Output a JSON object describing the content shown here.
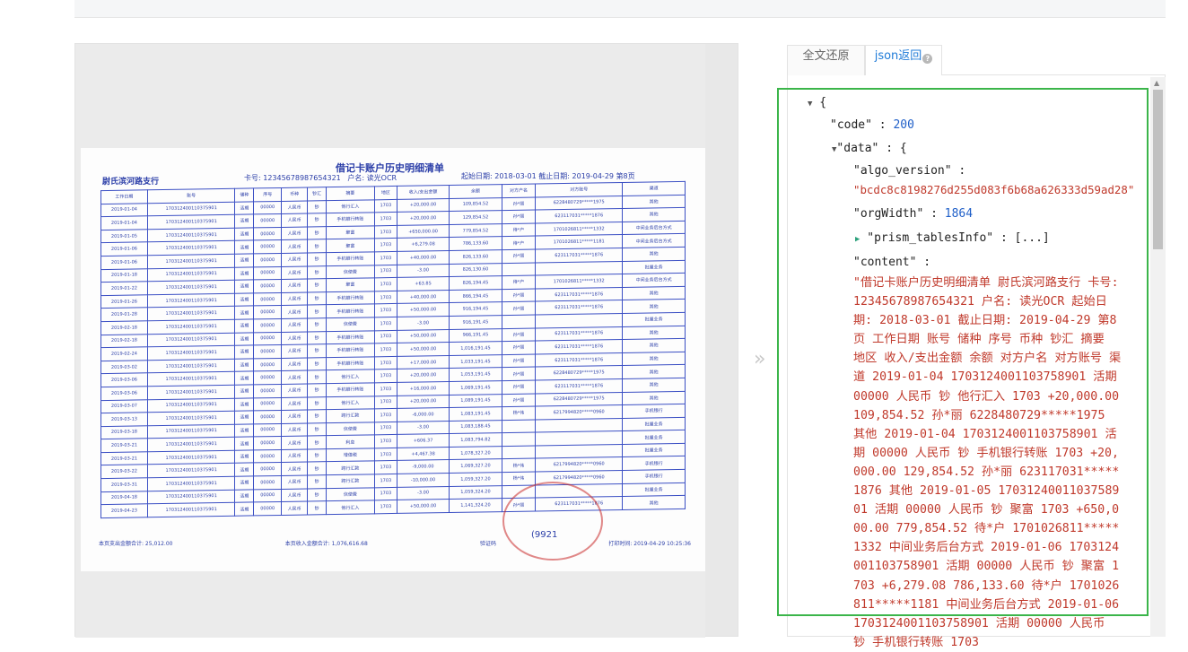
{
  "preview": {
    "doc_title": "借记卡账户历史明细清单",
    "bank": "尉氏滨河路支行",
    "card_label": "卡号: 12345678987654321",
    "owner": "户名: 读光OCR",
    "period": "起始日期: 2018-03-01  截止日期: 2019-04-29  第8页",
    "headers": [
      "工作日期",
      "账号",
      "储种",
      "序号",
      "币种",
      "钞汇",
      "摘要",
      "地区",
      "收入/支出金额",
      "余额",
      "对方户名",
      "对方账号",
      "渠道"
    ],
    "rows": [
      [
        "2019-01-04",
        "170312400110375901",
        "活期",
        "00000",
        "人民币",
        "钞",
        "他行汇入",
        "1703",
        "+20,000.00",
        "109,854.52",
        "孙*丽",
        "6228480729*****1975",
        "其他"
      ],
      [
        "2019-01-04",
        "170312400110375901",
        "活期",
        "00000",
        "人民币",
        "钞",
        "手机银行转账",
        "1703",
        "+20,000.00",
        "129,854.52",
        "孙*丽",
        "623117031*****1876",
        "其他"
      ],
      [
        "2019-01-05",
        "170312400110375901",
        "活期",
        "00000",
        "人民币",
        "钞",
        "聚富",
        "1703",
        "+650,000.00",
        "779,854.52",
        "待*户",
        "1701026811*****1332",
        "中间业务后台方式"
      ],
      [
        "2019-01-06",
        "170312400110375901",
        "活期",
        "00000",
        "人民币",
        "钞",
        "聚富",
        "1703",
        "+6,279.08",
        "786,133.60",
        "待*户",
        "1701026811*****1181",
        "中间业务后台方式"
      ],
      [
        "2019-01-06",
        "170312400110375901",
        "活期",
        "00000",
        "人民币",
        "钞",
        "手机银行转账",
        "1703",
        "+40,000.00",
        "826,133.60",
        "孙*丽",
        "623117031*****1876",
        "其他"
      ],
      [
        "2019-01-18",
        "170312400110375901",
        "活期",
        "00000",
        "人民币",
        "钞",
        "信使费",
        "1703",
        "-3.00",
        "826,130.60",
        "",
        "",
        "批量业务"
      ],
      [
        "2019-01-22",
        "170312400110375901",
        "活期",
        "00000",
        "人民币",
        "钞",
        "聚富",
        "1703",
        "+63.85",
        "826,194.45",
        "待*户",
        "1701026811*****1332",
        "中间业务后台方式"
      ],
      [
        "2019-01-26",
        "170312400110375901",
        "活期",
        "00000",
        "人民币",
        "钞",
        "手机银行转账",
        "1703",
        "+40,000.00",
        "866,194.45",
        "孙*丽",
        "623117031*****1876",
        "其他"
      ],
      [
        "2019-01-28",
        "170312400110375901",
        "活期",
        "00000",
        "人民币",
        "钞",
        "手机银行转账",
        "1703",
        "+50,000.00",
        "916,194.45",
        "孙*丽",
        "623117031*****1876",
        "其他"
      ],
      [
        "2019-02-18",
        "170312400110375901",
        "活期",
        "00000",
        "人民币",
        "钞",
        "信使费",
        "1703",
        "-3.00",
        "916,191.45",
        "",
        "",
        "批量业务"
      ],
      [
        "2019-02-18",
        "170312400110375901",
        "活期",
        "00000",
        "人民币",
        "钞",
        "手机银行转账",
        "1703",
        "+50,000.00",
        "966,191.45",
        "孙*丽",
        "623117031*****1876",
        "其他"
      ],
      [
        "2019-02-24",
        "170312400110375901",
        "活期",
        "00000",
        "人民币",
        "钞",
        "手机银行转账",
        "1703",
        "+50,000.00",
        "1,016,191.45",
        "孙*丽",
        "623117031*****1876",
        "其他"
      ],
      [
        "2019-03-02",
        "170312400110375901",
        "活期",
        "00000",
        "人民币",
        "钞",
        "手机银行转账",
        "1703",
        "+17,000.00",
        "1,033,191.45",
        "孙*丽",
        "623117031*****1876",
        "其他"
      ],
      [
        "2019-03-06",
        "170312400110375901",
        "活期",
        "00000",
        "人民币",
        "钞",
        "他行汇入",
        "1703",
        "+20,000.00",
        "1,053,191.45",
        "孙*丽",
        "6228480729*****1975",
        "其他"
      ],
      [
        "2019-03-06",
        "170312400110375901",
        "活期",
        "00000",
        "人民币",
        "钞",
        "手机银行转账",
        "1703",
        "+16,000.00",
        "1,069,191.45",
        "孙*丽",
        "623117031*****1876",
        "其他"
      ],
      [
        "2019-03-07",
        "170312400110375901",
        "活期",
        "00000",
        "人民币",
        "钞",
        "他行汇入",
        "1703",
        "+20,000.00",
        "1,089,191.45",
        "孙*丽",
        "6228480729*****1975",
        "其他"
      ],
      [
        "2019-03-13",
        "170312400110375901",
        "活期",
        "00000",
        "人民币",
        "钞",
        "跨行汇款",
        "1703",
        "-6,000.00",
        "1,083,191.45",
        "杨*伟",
        "6217994820*****0960",
        "手机银行"
      ],
      [
        "2019-03-18",
        "170312400110375901",
        "活期",
        "00000",
        "人民币",
        "钞",
        "信使费",
        "1703",
        "-3.00",
        "1,083,188.45",
        "",
        "",
        "批量业务"
      ],
      [
        "2019-03-21",
        "170312400110375901",
        "活期",
        "00000",
        "人民币",
        "钞",
        "利息",
        "1703",
        "+606.37",
        "1,083,794.82",
        "",
        "",
        "批量业务"
      ],
      [
        "2019-03-21",
        "170312400110375901",
        "活期",
        "00000",
        "人民币",
        "钞",
        "增值税",
        "1703",
        "+4,467.38",
        "1,078,327.20",
        "",
        "",
        "批量业务"
      ],
      [
        "2019-03-22",
        "170312400110375901",
        "活期",
        "00000",
        "人民币",
        "钞",
        "跨行汇款",
        "1703",
        "-9,000.00",
        "1,069,327.20",
        "杨*伟",
        "6217994820*****0960",
        "手机银行"
      ],
      [
        "2019-03-31",
        "170312400110375901",
        "活期",
        "00000",
        "人民币",
        "钞",
        "跨行汇款",
        "1703",
        "-10,000.00",
        "1,059,327.20",
        "杨*伟",
        "6217994820*****0960",
        "手机银行"
      ],
      [
        "2019-04-18",
        "170312400110375901",
        "活期",
        "00000",
        "人民币",
        "钞",
        "信使费",
        "1703",
        "-3.00",
        "1,059,324.20",
        "",
        "",
        "批量业务"
      ],
      [
        "2019-04-23",
        "170312400110375901",
        "活期",
        "00000",
        "人民币",
        "钞",
        "他行汇入",
        "1703",
        "+50,000.00",
        "1,141,324.20",
        "孙*丽",
        "623117031*****1876",
        "其他"
      ]
    ],
    "footer_left": "本页支出金额合计: 25,012.00",
    "footer_mid": "本页收入金额合计: 1,076,616.68",
    "footer_right": "验证码",
    "footer_print": "打印时间: 2019-04-29 10:25:36",
    "stamp_text": "(9921"
  },
  "tabs": {
    "full_text": "全文还原",
    "json_return": "json返回",
    "help": "?"
  },
  "json_view": {
    "open_brace": "{",
    "code_key": "\"code\"",
    "code_val": "200",
    "data_key": "\"data\"",
    "data_open": "{",
    "algo_key": "\"algo_version\"",
    "algo_val": "\"bcdc8c8198276d255d083f6b68a626333d59ad28\"",
    "orgwidth_key": "\"orgWidth\"",
    "orgwidth_val": "1864",
    "prism_key": "\"prism_tablesInfo\"",
    "prism_val": "[...]",
    "content_key": "\"content\"",
    "content_val": "\"借记卡账户历史明细清单 尉氏滨河路支行 卡号: 12345678987654321 户名: 读光OCR 起始日期: 2018-03-01 截止日期: 2019-04-29 第8页 工作日期 账号 储种 序号 币种 钞汇 摘要 地区 收入/支出金额 余额 对方户名 对方账号 渠道 2019-01-04 1703124001103758901 活期 00000 人民币 钞 他行汇入 1703 +20,000.00 109,854.52 孙*丽 6228480729*****1975 其他 2019-01-04 1703124001103758901 活期 00000 人民币 钞 手机银行转账 1703 +20,000.00 129,854.52 孙*丽 623117031*****1876 其他 2019-01-05 1703124001103758901 活期 00000 人民币 钞 聚富 1703 +650,000.00 779,854.52 待*户 1701026811*****1332 中间业务后台方式 2019-01-06 1703124001103758901 活期 00000 人民币 钞 聚富 1703 +6,279.08 786,133.60 待*户 1701026811*****1181 中间业务后台方式 2019-01-06 1703124001103758901 活期 00000 人民币 钞 手机银行转账 1703"
  },
  "colors": {
    "accent": "#1f7bd8",
    "highlight": "#3bb54a",
    "json_string": "#c0392b",
    "json_number": "#1f5fc8"
  }
}
